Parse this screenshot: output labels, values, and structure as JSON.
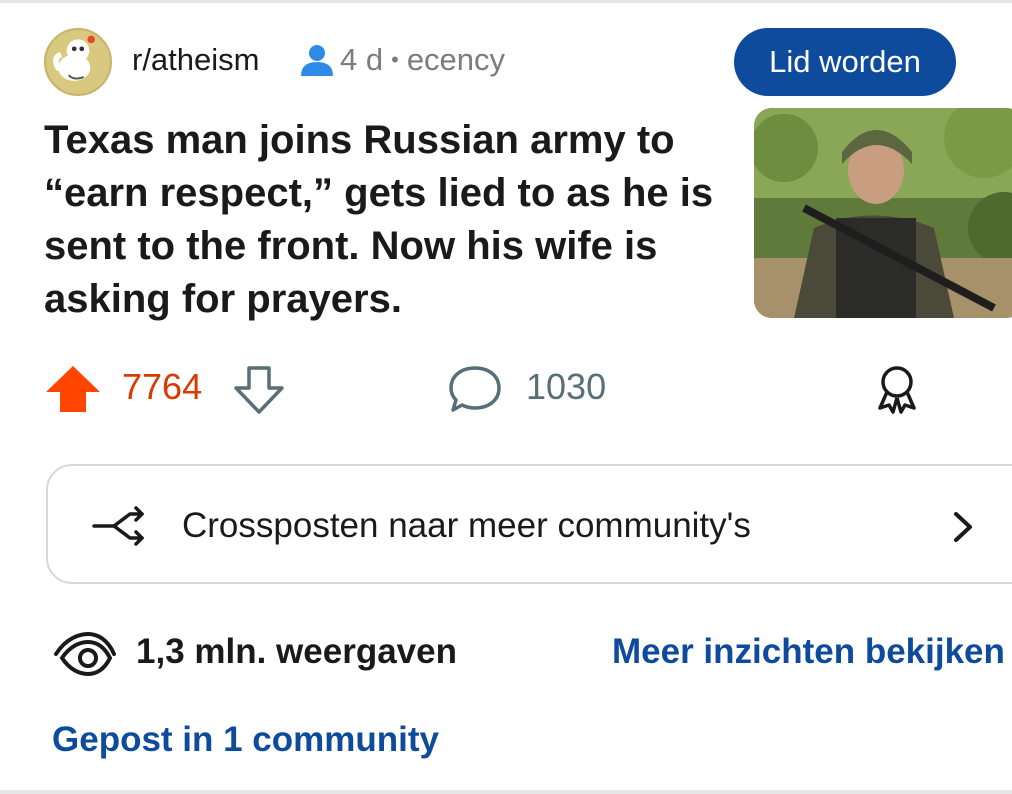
{
  "post": {
    "subreddit": "r/atheism",
    "age": "4 d",
    "separator": "•",
    "author": "ecency",
    "join_label": "Lid worden",
    "title": "Texas man joins Russian army to “earn respect,” gets lied to as he is sent to the front. Now his wife is asking for prayers.",
    "score": "7764",
    "comments": "1030"
  },
  "crosspost": {
    "label": "Crossposten naar meer community's"
  },
  "stats": {
    "views": "1,3 mln. weergaven",
    "insights_link": "Meer inzichten bekijken",
    "posted_in": "Gepost in 1 community"
  },
  "colors": {
    "accent": "#0e4b9d",
    "upvote": "#ff4500",
    "score": "#d93a00",
    "muted": "#7c7c7c"
  },
  "icons": {
    "avatar": "reddit-snoo-avatar",
    "author": "person-icon",
    "upvote": "upvote-arrow-icon",
    "downvote": "downvote-arrow-icon",
    "comment": "speech-bubble-icon",
    "award": "award-ribbon-icon",
    "crosspost": "crosspost-arrows-icon",
    "chevron": "chevron-right-icon",
    "views": "eye-icon"
  }
}
